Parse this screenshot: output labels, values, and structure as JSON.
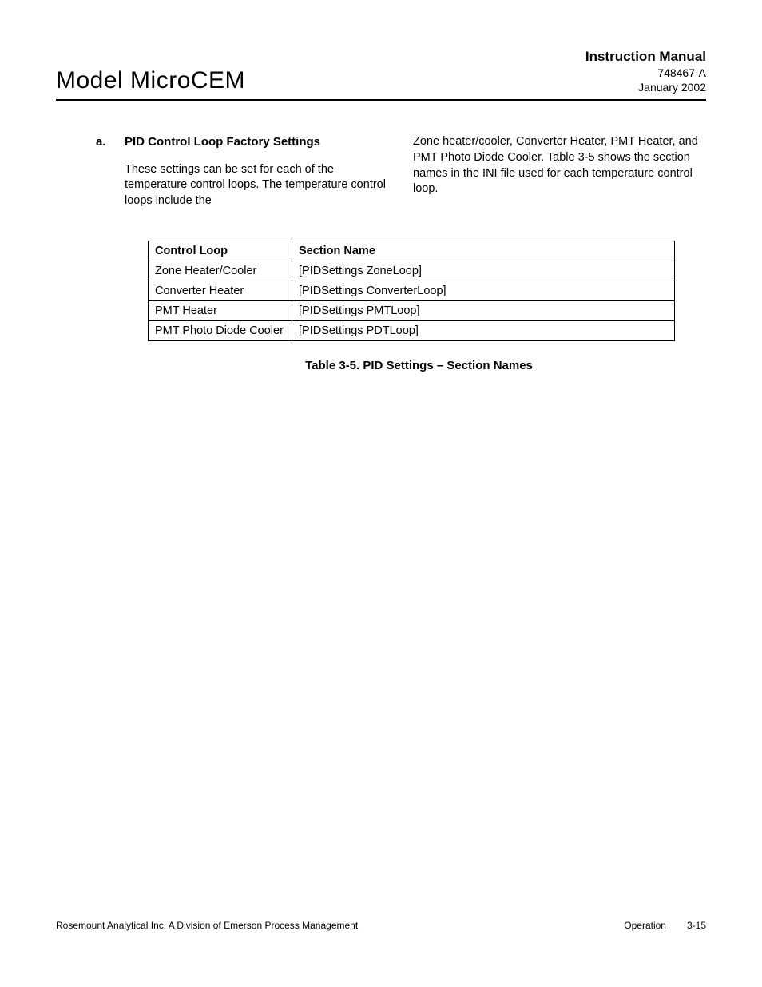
{
  "header": {
    "model": "Model MicroCEM",
    "manual_title": "Instruction Manual",
    "doc_number": "748467-A",
    "doc_date": "January 2002"
  },
  "section": {
    "letter": "a.",
    "title": "PID Control Loop Factory Settings",
    "para_left": "These settings can be set for each of the temperature control loops.  The temperature control loops include the",
    "para_right": "Zone heater/cooler, Converter Heater, PMT Heater, and PMT Photo Diode Cooler.  Table 3-5 shows the section names in the INI file used for each temperature control loop."
  },
  "table": {
    "caption": "Table 3-5.  PID Settings – Section Names",
    "headers": [
      "Control Loop",
      "Section Name"
    ],
    "rows": [
      [
        "Zone Heater/Cooler",
        "[PIDSettings ZoneLoop]"
      ],
      [
        "Converter Heater",
        "[PIDSettings ConverterLoop]"
      ],
      [
        "PMT Heater",
        "[PIDSettings PMTLoop]"
      ],
      [
        "PMT Photo Diode Cooler",
        "[PIDSettings PDTLoop]"
      ]
    ]
  },
  "footer": {
    "left": "Rosemount Analytical Inc.    A Division of Emerson Process Management",
    "section": "Operation",
    "page": "3-15"
  }
}
